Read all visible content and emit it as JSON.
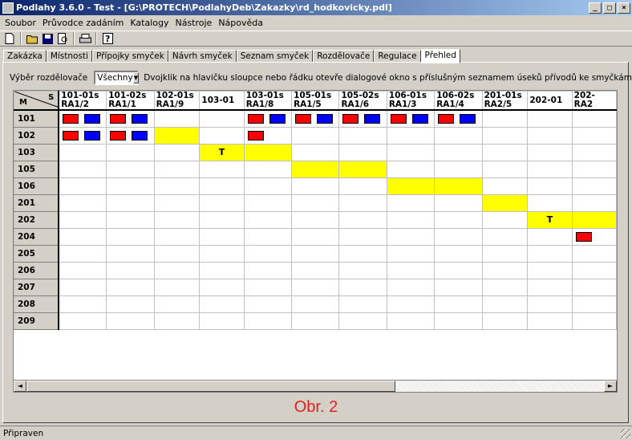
{
  "window": {
    "title": "Podlahy 3.6.0 - Test - [G:\\PROTECH\\PodlahyDeb\\Zakazky\\rd_hodkovicky.pdl]",
    "minimize": "_",
    "maximize": "□",
    "close": "×"
  },
  "menu": [
    "Soubor",
    "Průvodce zadáním",
    "Katalogy",
    "Nástroje",
    "Nápověda"
  ],
  "toolbar": {
    "new": "🗋",
    "open": "📂",
    "save": "💾",
    "preview": "🔍",
    "print": "🖶",
    "help": "?"
  },
  "tabs": [
    {
      "label": "Zakázka",
      "active": false
    },
    {
      "label": "Místnosti",
      "active": false
    },
    {
      "label": "Přípojky smyček",
      "active": false
    },
    {
      "label": "Návrh smyček",
      "active": false
    },
    {
      "label": "Seznam smyček",
      "active": false
    },
    {
      "label": "Rozdělovače",
      "active": false
    },
    {
      "label": "Regulace",
      "active": false
    },
    {
      "label": "Přehled",
      "active": true
    }
  ],
  "selector": {
    "label": "Výběr rozdělovače",
    "value": "Všechny",
    "hint": "Dvojklik na hlavičku sloupce nebo řádku otevře dialogové okno s příslušným seznamem úseků přívodů ke smyčkám"
  },
  "grid": {
    "corner_row": "M",
    "corner_col": "S",
    "columns": [
      {
        "l1": "101-01s",
        "l2": "RA1/2"
      },
      {
        "l1": "101-02s",
        "l2": "RA1/1"
      },
      {
        "l1": "102-01s",
        "l2": "RA1/9"
      },
      {
        "l1": "103-01",
        "l2": ""
      },
      {
        "l1": "103-01s",
        "l2": "RA1/8"
      },
      {
        "l1": "105-01s",
        "l2": "RA1/5"
      },
      {
        "l1": "105-02s",
        "l2": "RA1/6"
      },
      {
        "l1": "106-01s",
        "l2": "RA1/3"
      },
      {
        "l1": "106-02s",
        "l2": "RA1/4"
      },
      {
        "l1": "201-01s",
        "l2": "RA2/5"
      },
      {
        "l1": "202-01",
        "l2": ""
      },
      {
        "l1": "202-",
        "l2": "RA2"
      }
    ],
    "rows": [
      {
        "label": "101",
        "cells": [
          "rb",
          "rb",
          "",
          "",
          "rb",
          "rb",
          "rb",
          "rb",
          "rb",
          "",
          "",
          ""
        ]
      },
      {
        "label": "102",
        "cells": [
          "rb",
          "rb",
          "y",
          "",
          "r",
          "",
          "",
          "",
          "",
          "",
          "",
          ""
        ]
      },
      {
        "label": "103",
        "cells": [
          "",
          "",
          "",
          "yT",
          "y",
          "",
          "",
          "",
          "",
          "",
          "",
          ""
        ]
      },
      {
        "label": "105",
        "cells": [
          "",
          "",
          "",
          "",
          "",
          "y",
          "y",
          "",
          "",
          "",
          "",
          ""
        ]
      },
      {
        "label": "106",
        "cells": [
          "",
          "",
          "",
          "",
          "",
          "",
          "",
          "y",
          "y",
          "",
          "",
          ""
        ]
      },
      {
        "label": "201",
        "cells": [
          "",
          "",
          "",
          "",
          "",
          "",
          "",
          "",
          "",
          "y",
          "",
          ""
        ]
      },
      {
        "label": "202",
        "cells": [
          "",
          "",
          "",
          "",
          "",
          "",
          "",
          "",
          "",
          "",
          "yT",
          "y"
        ]
      },
      {
        "label": "204",
        "cells": [
          "",
          "",
          "",
          "",
          "",
          "",
          "",
          "",
          "",
          "",
          "",
          "r"
        ]
      },
      {
        "label": "205",
        "cells": [
          "",
          "",
          "",
          "",
          "",
          "",
          "",
          "",
          "",
          "",
          "",
          ""
        ]
      },
      {
        "label": "206",
        "cells": [
          "",
          "",
          "",
          "",
          "",
          "",
          "",
          "",
          "",
          "",
          "",
          ""
        ]
      },
      {
        "label": "207",
        "cells": [
          "",
          "",
          "",
          "",
          "",
          "",
          "",
          "",
          "",
          "",
          "",
          ""
        ]
      },
      {
        "label": "208",
        "cells": [
          "",
          "",
          "",
          "",
          "",
          "",
          "",
          "",
          "",
          "",
          "",
          ""
        ]
      },
      {
        "label": "209",
        "cells": [
          "",
          "",
          "",
          "",
          "",
          "",
          "",
          "",
          "",
          "",
          "",
          ""
        ]
      }
    ],
    "marker_text": "T"
  },
  "scroll": {
    "left": "◄",
    "right": "►"
  },
  "caption": "Obr. 2",
  "status": "Připraven",
  "colors": {
    "titlebar": "#0a246a",
    "yellow": "#ffff00",
    "red": "#ff0000",
    "blue": "#0000ff",
    "caption": "#e02020"
  }
}
